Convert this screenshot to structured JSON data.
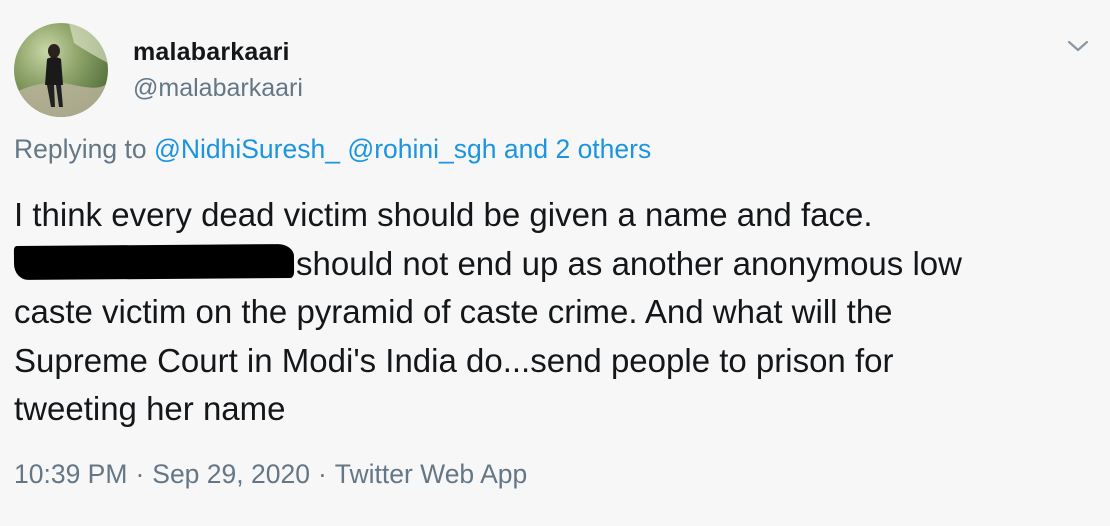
{
  "author": {
    "display_name": "malabarkaari",
    "handle": "@malabarkaari"
  },
  "menu": {
    "icon": "chevron-down-icon"
  },
  "reply": {
    "prefix": "Replying to",
    "mentions": [
      "@NidhiSuresh_",
      "@rohini_sgh"
    ],
    "others": "and 2 others"
  },
  "tweet": {
    "line1": "I think every dead victim should be given a name and face.",
    "line2_after_redaction": "should not end up as another anonymous low",
    "line3": "caste victim on the pyramid of caste crime. And what will the",
    "line4": "Supreme Court in Modi's India do...send people to prison for",
    "line5": "tweeting her name"
  },
  "meta": {
    "time": "10:39 PM",
    "separator": "·",
    "date": "Sep 29, 2020",
    "source": "Twitter Web App"
  },
  "colors": {
    "background": "#f7f7f7",
    "text": "#14171a",
    "secondary": "#657786",
    "link": "#1b95e0"
  }
}
